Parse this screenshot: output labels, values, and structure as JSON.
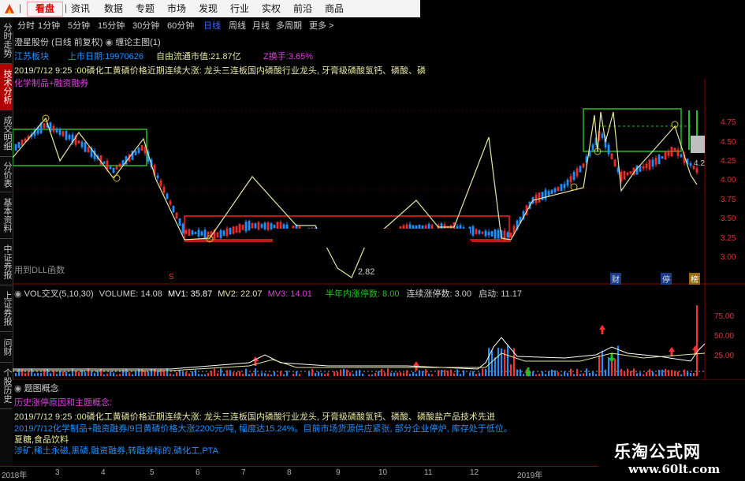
{
  "menu": {
    "kanpan": "看盘",
    "items": [
      "资讯",
      "数据",
      "专题",
      "市场",
      "发现",
      "行业",
      "实权",
      "前沿",
      "商品"
    ]
  },
  "periods": [
    "分时",
    "1分钟",
    "5分钟",
    "15分钟",
    "30分钟",
    "60分钟",
    "日线",
    "周线",
    "月线",
    "多周期",
    "更多 >"
  ],
  "active_period": "日线",
  "left_tabs": [
    "分时走势",
    "技术分析",
    "成交明细",
    "分价表",
    "基本资料",
    "中证券报",
    "上证券报",
    "问财",
    "个股历史"
  ],
  "stock": {
    "name": "澄星股份",
    "mode": "(日线 前复权)",
    "indicator": "缠论主图(1)",
    "sector": "江苏板块",
    "listing_label": "上市日期:",
    "listing_date": "19970626",
    "float_cap_label": "自由流通市值:",
    "float_cap": "21.87亿",
    "turnover_label": "Z换手:",
    "turnover": "3.65%",
    "news1_time": "2019/7/12 9:25 :00",
    "news1_text": "磷化工黄磷价格近期连续大涨: 龙头三连板国内磷酸行业龙头, 牙膏级磷酸氢钙、磷酸、磷",
    "concept_line": "化学制品+融资融券",
    "dll_note": "用到DLL函数",
    "low_price_label": "2.82",
    "high_price_label": "4.2"
  },
  "price_axis": [
    "4.75",
    "4.50",
    "4.25",
    "4.00",
    "3.75",
    "3.50",
    "3.25",
    "3.00"
  ],
  "signal_tags": [
    "财",
    "停",
    "榜"
  ],
  "volume_header": {
    "name": "VOL交叉(5,10,30)",
    "volume": "VOLUME: 14.08",
    "mv1": "MV1: 35.87",
    "mv2": "MV2: 22.07",
    "mv3": "MV3: 14.01",
    "half_year": "半年内涨停数: 8.00",
    "consecutive": "连续涨停数: 3.00",
    "start": "启动: 11.17"
  },
  "volume_axis": [
    "75.00",
    "50.00",
    "25.00"
  ],
  "bottom": {
    "title": "题图概念",
    "header": "历史涨停原因和主题概念:",
    "line1": "2019/7/12 9:25 :00磷化工黄磷价格近期连续大涨: 龙头三连板国内磷酸行业龙头, 牙膏级磷酸氢钙、磷酸、磷酸盐产品技术先进",
    "line2": "2019/7/12化学制品+融资融券/9日黄磷价格大涨2200元/吨, 幅度达15.24%。目前市场货源供应紧张, 部分企业停炉, 库存处于低位。",
    "line3": "夏糖,食品饮料",
    "line4": "涉矿,稀土永磁,黑磷,融资融券,转融券标的,磷化工,PTA"
  },
  "x_axis": [
    "2018年",
    "3",
    "4",
    "5",
    "6",
    "7",
    "8",
    "9",
    "10",
    "11",
    "12",
    "2019年"
  ],
  "watermark": {
    "cn": "乐淘公式网",
    "url": "www.60lt.com"
  },
  "colors": {
    "up": "#ff3030",
    "down": "#1e90ff",
    "zigzag": "#e6e6a0",
    "box_green": "#22c022",
    "box_red": "#ff2020"
  }
}
